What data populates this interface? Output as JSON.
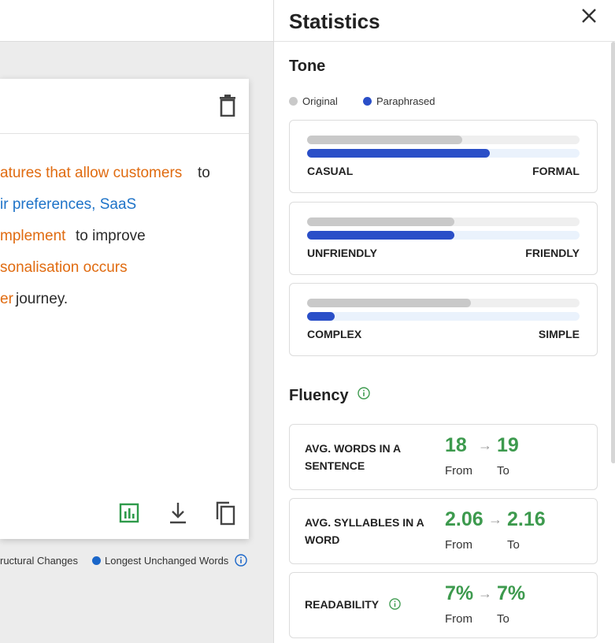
{
  "document": {
    "lines": [
      [
        {
          "text": "atures that allow customers",
          "style": "orange"
        },
        {
          "text": " to",
          "style": "dark"
        }
      ],
      [
        {
          "text": "ir preferences, SaaS",
          "style": "blue"
        }
      ],
      [
        {
          "text": "mplement",
          "style": "orange"
        },
        {
          "text": " to improve",
          "style": "dark"
        }
      ],
      [
        {
          "text": "sonalisation occurs",
          "style": "orange"
        }
      ],
      [
        {
          "text": "er",
          "style": "orange"
        },
        {
          "text": " journey.",
          "style": "dark"
        }
      ]
    ],
    "icons": {
      "delete": "trash-icon",
      "stats": "bar-chart-icon",
      "download": "download-icon",
      "copy": "copy-icon"
    }
  },
  "legend": {
    "structural": "ructural Changes",
    "unchanged": "Longest Unchanged Words"
  },
  "panel": {
    "title": "Statistics",
    "close_icon": "close-icon",
    "tone": {
      "title": "Tone",
      "legend_original": "Original",
      "legend_paraphrased": "Paraphrased",
      "colors": {
        "original": "#c9c9c9",
        "paraphrased": "#2a4fc8"
      },
      "scales": [
        {
          "left": "CASUAL",
          "right": "FORMAL",
          "original": 0.57,
          "paraphrased": 0.67
        },
        {
          "left": "UNFRIENDLY",
          "right": "FRIENDLY",
          "original": 0.54,
          "paraphrased": 0.54
        },
        {
          "left": "COMPLEX",
          "right": "SIMPLE",
          "original": 0.6,
          "paraphrased": 0.1
        }
      ]
    },
    "fluency": {
      "title": "Fluency",
      "metrics": [
        {
          "label": "AVG. WORDS IN A SENTENCE",
          "from": "18",
          "to": "19",
          "from_label": "From",
          "to_label": "To"
        },
        {
          "label": "AVG. SYLLABLES IN A WORD",
          "from": "2.06",
          "to": "2.16",
          "from_label": "From",
          "to_label": "To"
        },
        {
          "label": "READABILITY",
          "from": "7%",
          "to": "7%",
          "from_label": "From",
          "to_label": "To"
        }
      ]
    }
  }
}
